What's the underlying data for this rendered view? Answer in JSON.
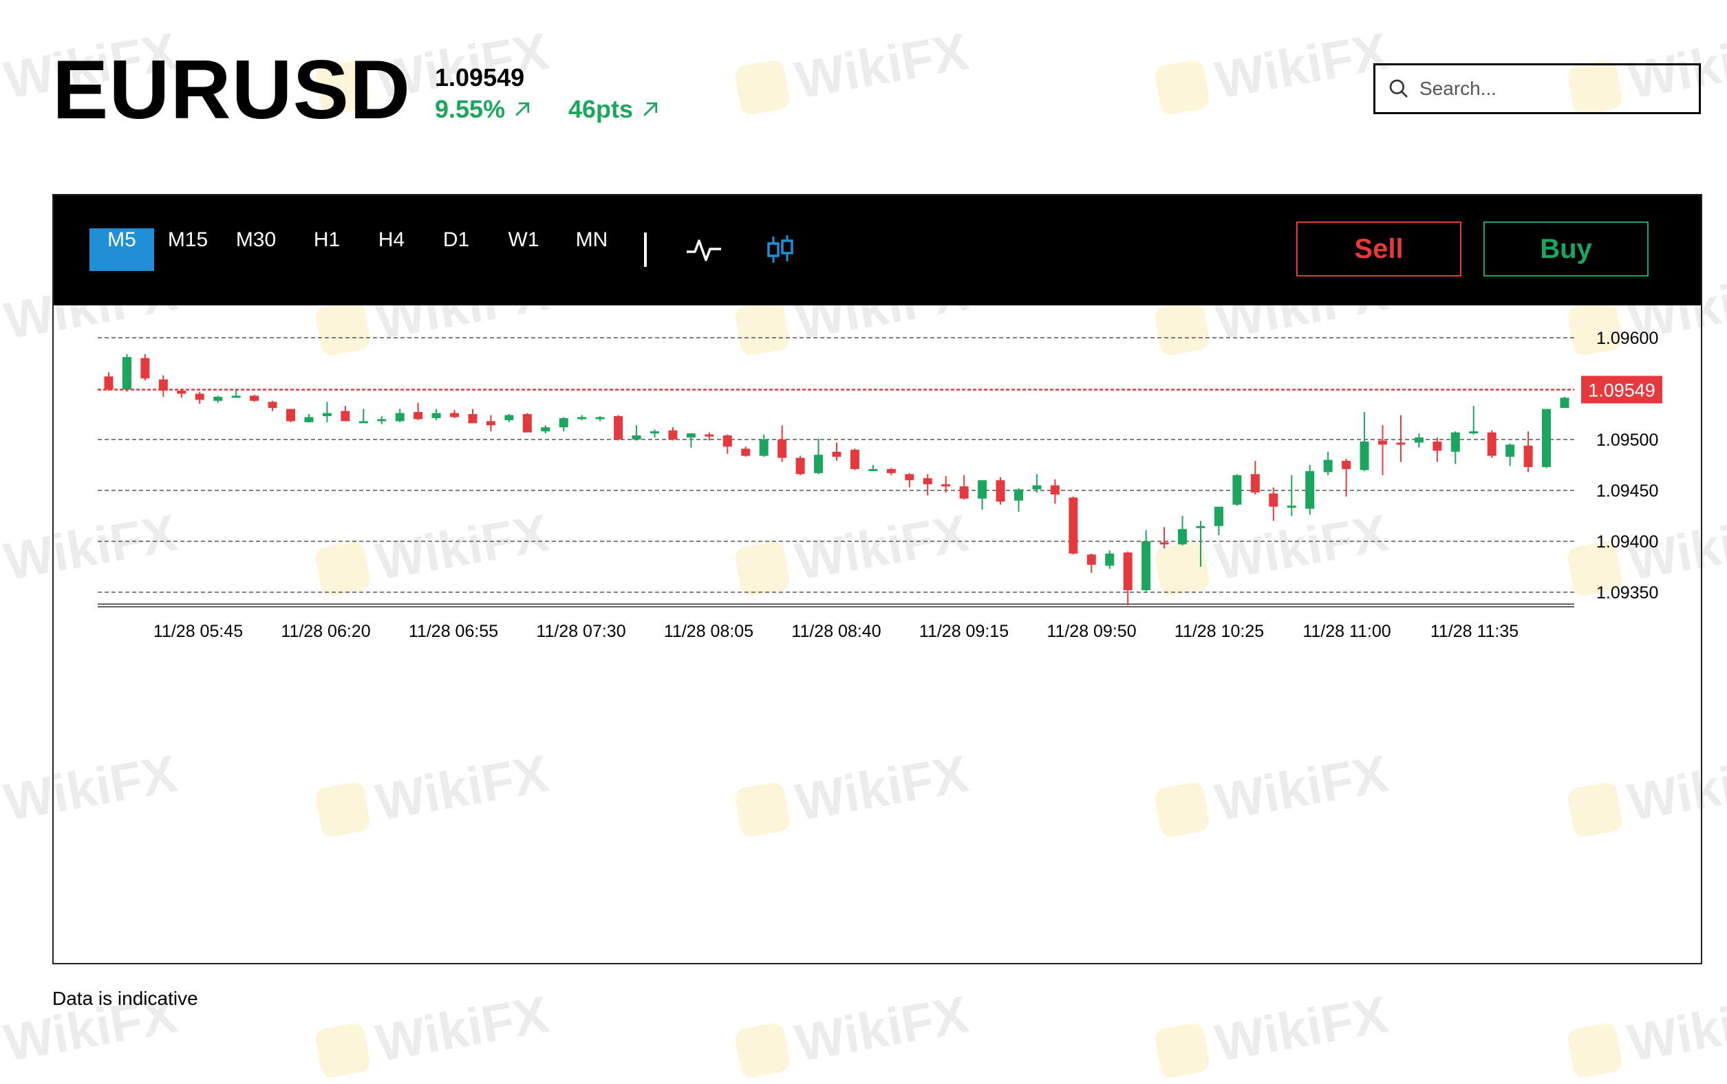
{
  "header": {
    "symbol": "EURUSD",
    "price": "1.09549",
    "change_pct": "9.55%",
    "change_pts": "46pts",
    "trend_icon": "arrow-up-right-icon",
    "up_color": "#1aa65c"
  },
  "search": {
    "placeholder": "Search...",
    "value": ""
  },
  "toolbar": {
    "timeframes": [
      "M5",
      "M15",
      "M30",
      "H1",
      "H4",
      "D1",
      "W1",
      "MN"
    ],
    "active_timeframe": "M5",
    "line_chart_icon": "line-chart-icon",
    "candlestick_icon": "candlestick-icon",
    "sell_label": "Sell",
    "buy_label": "Buy",
    "sell_color": "#e5393d",
    "buy_color": "#1aa65c",
    "active_color": "#1f8fd6"
  },
  "watermark": "WikiFX",
  "footer": {
    "note": "Data is indicative"
  },
  "chart_data": {
    "type": "candlestick",
    "y_ticks": [
      "1.09600",
      "1.09500",
      "1.09450",
      "1.09400",
      "1.09350"
    ],
    "ylim": [
      1.09337,
      1.09617
    ],
    "grid": "dashed horizontal",
    "current_price": {
      "label": "1.09549",
      "value": 1.09549,
      "color": "#e5393d"
    },
    "x_ticks": [
      "11/28 05:45",
      "11/28 06:20",
      "11/28 06:55",
      "11/28 07:30",
      "11/28 08:05",
      "11/28 08:40",
      "11/28 09:15",
      "11/28 09:50",
      "11/28 10:25",
      "11/28 11:00",
      "11/28 11:35"
    ],
    "up_color": "#1aa65c",
    "down_color": "#e5393d",
    "candles": [
      {
        "o": 1.09562,
        "h": 1.09566,
        "l": 1.09548,
        "c": 1.09549
      },
      {
        "o": 1.09549,
        "h": 1.09584,
        "l": 1.09547,
        "c": 1.09581
      },
      {
        "o": 1.0958,
        "h": 1.09584,
        "l": 1.09558,
        "c": 1.0956
      },
      {
        "o": 1.09559,
        "h": 1.09563,
        "l": 1.09542,
        "c": 1.09548
      },
      {
        "o": 1.09548,
        "h": 1.0955,
        "l": 1.09541,
        "c": 1.09545
      },
      {
        "o": 1.09545,
        "h": 1.09547,
        "l": 1.09535,
        "c": 1.09539
      },
      {
        "o": 1.09538,
        "h": 1.09543,
        "l": 1.09536,
        "c": 1.09542
      },
      {
        "o": 1.09543,
        "h": 1.09549,
        "l": 1.09541,
        "c": 1.09543
      },
      {
        "o": 1.09543,
        "h": 1.09544,
        "l": 1.09537,
        "c": 1.09538
      },
      {
        "o": 1.09537,
        "h": 1.09538,
        "l": 1.09528,
        "c": 1.09531
      },
      {
        "o": 1.0953,
        "h": 1.0953,
        "l": 1.09517,
        "c": 1.09518
      },
      {
        "o": 1.09517,
        "h": 1.09525,
        "l": 1.09517,
        "c": 1.09522
      },
      {
        "o": 1.09523,
        "h": 1.09537,
        "l": 1.09517,
        "c": 1.09526
      },
      {
        "o": 1.09528,
        "h": 1.09533,
        "l": 1.09518,
        "c": 1.09518
      },
      {
        "o": 1.09518,
        "h": 1.0953,
        "l": 1.09517,
        "c": 1.09518
      },
      {
        "o": 1.09518,
        "h": 1.09523,
        "l": 1.09515,
        "c": 1.0952
      },
      {
        "o": 1.09518,
        "h": 1.0953,
        "l": 1.09517,
        "c": 1.09526
      },
      {
        "o": 1.09527,
        "h": 1.09536,
        "l": 1.09519,
        "c": 1.0952
      },
      {
        "o": 1.09521,
        "h": 1.0953,
        "l": 1.09519,
        "c": 1.09526
      },
      {
        "o": 1.09526,
        "h": 1.09529,
        "l": 1.09521,
        "c": 1.09522
      },
      {
        "o": 1.09525,
        "h": 1.0953,
        "l": 1.09516,
        "c": 1.09516
      },
      {
        "o": 1.09518,
        "h": 1.09524,
        "l": 1.09508,
        "c": 1.09514
      },
      {
        "o": 1.09519,
        "h": 1.09525,
        "l": 1.09517,
        "c": 1.09524
      },
      {
        "o": 1.09525,
        "h": 1.09526,
        "l": 1.09507,
        "c": 1.09507
      },
      {
        "o": 1.09508,
        "h": 1.09514,
        "l": 1.09506,
        "c": 1.09512
      },
      {
        "o": 1.09512,
        "h": 1.09522,
        "l": 1.09508,
        "c": 1.09521
      },
      {
        "o": 1.09522,
        "h": 1.09524,
        "l": 1.09519,
        "c": 1.09522
      },
      {
        "o": 1.0952,
        "h": 1.09523,
        "l": 1.09518,
        "c": 1.09522
      },
      {
        "o": 1.09523,
        "h": 1.09524,
        "l": 1.09499,
        "c": 1.095
      },
      {
        "o": 1.095,
        "h": 1.09514,
        "l": 1.09499,
        "c": 1.09504
      },
      {
        "o": 1.09506,
        "h": 1.0951,
        "l": 1.09502,
        "c": 1.09508
      },
      {
        "o": 1.09509,
        "h": 1.09512,
        "l": 1.09499,
        "c": 1.095
      },
      {
        "o": 1.09502,
        "h": 1.09506,
        "l": 1.09492,
        "c": 1.09506
      },
      {
        "o": 1.09505,
        "h": 1.09507,
        "l": 1.09499,
        "c": 1.09503
      },
      {
        "o": 1.09504,
        "h": 1.09505,
        "l": 1.09486,
        "c": 1.09493
      },
      {
        "o": 1.09491,
        "h": 1.09493,
        "l": 1.09483,
        "c": 1.09484
      },
      {
        "o": 1.09484,
        "h": 1.09505,
        "l": 1.09483,
        "c": 1.095
      },
      {
        "o": 1.095,
        "h": 1.09514,
        "l": 1.09478,
        "c": 1.09482
      },
      {
        "o": 1.09482,
        "h": 1.09484,
        "l": 1.09465,
        "c": 1.09466
      },
      {
        "o": 1.09467,
        "h": 1.09501,
        "l": 1.09466,
        "c": 1.09485
      },
      {
        "o": 1.09488,
        "h": 1.09497,
        "l": 1.09479,
        "c": 1.09483
      },
      {
        "o": 1.0949,
        "h": 1.09491,
        "l": 1.0947,
        "c": 1.09471
      },
      {
        "o": 1.09471,
        "h": 1.09475,
        "l": 1.09469,
        "c": 1.09471
      },
      {
        "o": 1.09471,
        "h": 1.09472,
        "l": 1.09465,
        "c": 1.09467
      },
      {
        "o": 1.09466,
        "h": 1.09467,
        "l": 1.09453,
        "c": 1.0946
      },
      {
        "o": 1.09462,
        "h": 1.09466,
        "l": 1.09445,
        "c": 1.09456
      },
      {
        "o": 1.09456,
        "h": 1.09464,
        "l": 1.09448,
        "c": 1.09454
      },
      {
        "o": 1.09454,
        "h": 1.09465,
        "l": 1.09441,
        "c": 1.09442
      },
      {
        "o": 1.09442,
        "h": 1.0946,
        "l": 1.09431,
        "c": 1.0946
      },
      {
        "o": 1.0946,
        "h": 1.09463,
        "l": 1.09436,
        "c": 1.09439
      },
      {
        "o": 1.0944,
        "h": 1.09452,
        "l": 1.09429,
        "c": 1.09451
      },
      {
        "o": 1.09451,
        "h": 1.09466,
        "l": 1.09448,
        "c": 1.09455
      },
      {
        "o": 1.09455,
        "h": 1.09461,
        "l": 1.09437,
        "c": 1.09446
      },
      {
        "o": 1.09443,
        "h": 1.09444,
        "l": 1.09387,
        "c": 1.09388
      },
      {
        "o": 1.09387,
        "h": 1.09388,
        "l": 1.09369,
        "c": 1.09377
      },
      {
        "o": 1.09376,
        "h": 1.09391,
        "l": 1.09373,
        "c": 1.09388
      },
      {
        "o": 1.09389,
        "h": 1.0939,
        "l": 1.09337,
        "c": 1.09352
      },
      {
        "o": 1.09352,
        "h": 1.09411,
        "l": 1.09351,
        "c": 1.094
      },
      {
        "o": 1.09399,
        "h": 1.09414,
        "l": 1.09393,
        "c": 1.09397
      },
      {
        "o": 1.09397,
        "h": 1.09425,
        "l": 1.09396,
        "c": 1.09412
      },
      {
        "o": 1.09414,
        "h": 1.0942,
        "l": 1.09375,
        "c": 1.09415
      },
      {
        "o": 1.09415,
        "h": 1.09433,
        "l": 1.09406,
        "c": 1.09434
      },
      {
        "o": 1.09436,
        "h": 1.09466,
        "l": 1.09435,
        "c": 1.09465
      },
      {
        "o": 1.09466,
        "h": 1.09479,
        "l": 1.09446,
        "c": 1.09448
      },
      {
        "o": 1.09447,
        "h": 1.09453,
        "l": 1.0942,
        "c": 1.09434
      },
      {
        "o": 1.09433,
        "h": 1.09465,
        "l": 1.09425,
        "c": 1.09435
      },
      {
        "o": 1.09432,
        "h": 1.09475,
        "l": 1.09426,
        "c": 1.09469
      },
      {
        "o": 1.09468,
        "h": 1.09488,
        "l": 1.09465,
        "c": 1.0948
      },
      {
        "o": 1.09479,
        "h": 1.09481,
        "l": 1.09444,
        "c": 1.09471
      },
      {
        "o": 1.0947,
        "h": 1.09527,
        "l": 1.09469,
        "c": 1.09498
      },
      {
        "o": 1.09499,
        "h": 1.09514,
        "l": 1.09465,
        "c": 1.09495
      },
      {
        "o": 1.09497,
        "h": 1.09524,
        "l": 1.09478,
        "c": 1.09496
      },
      {
        "o": 1.09497,
        "h": 1.09506,
        "l": 1.09492,
        "c": 1.09502
      },
      {
        "o": 1.09498,
        "h": 1.09502,
        "l": 1.09478,
        "c": 1.09489
      },
      {
        "o": 1.09488,
        "h": 1.09508,
        "l": 1.09476,
        "c": 1.09507
      },
      {
        "o": 1.09508,
        "h": 1.09533,
        "l": 1.09505,
        "c": 1.09508
      },
      {
        "o": 1.09507,
        "h": 1.09509,
        "l": 1.09482,
        "c": 1.09484
      },
      {
        "o": 1.09483,
        "h": 1.09496,
        "l": 1.09474,
        "c": 1.09495
      },
      {
        "o": 1.09494,
        "h": 1.09508,
        "l": 1.09468,
        "c": 1.09473
      },
      {
        "o": 1.09473,
        "h": 1.09526,
        "l": 1.09472,
        "c": 1.0953
      },
      {
        "o": 1.09531,
        "h": 1.09542,
        "l": 1.09531,
        "c": 1.09541
      }
    ]
  }
}
